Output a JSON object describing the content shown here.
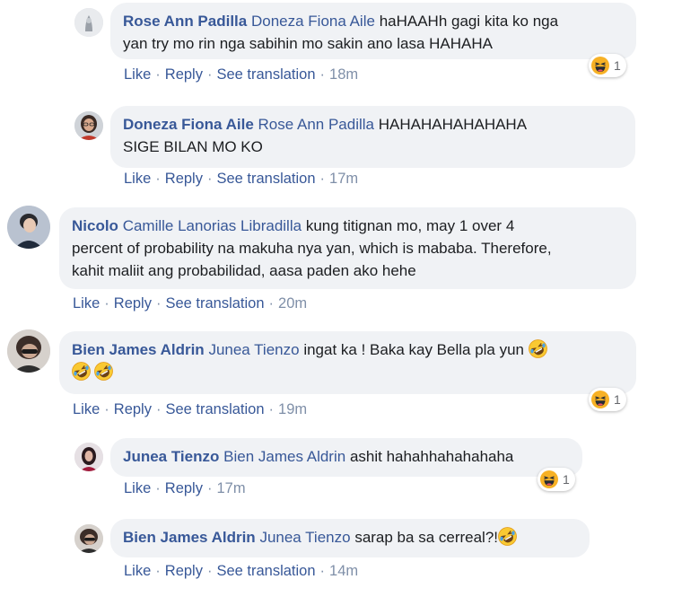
{
  "comments": [
    {
      "author": "Rose Ann Padilla",
      "tag": "Doneza Fiona Aile",
      "text_lines": [
        "haHAAHh gagi kita ko nga",
        "yan try mo rin nga sabihin mo sakin ano lasa HAHAHA"
      ],
      "actions": {
        "like": "Like",
        "reply": "Reply",
        "translate": "See translation",
        "time": "18m"
      },
      "reaction": {
        "icon": "haha-reaction-icon",
        "count": "1"
      }
    },
    {
      "author": "Doneza Fiona Aile",
      "tag": "Rose Ann Padilla",
      "text_lines": [
        "HAHAHAHAHAHAHA",
        "SIGE BILAN MO KO"
      ],
      "actions": {
        "like": "Like",
        "reply": "Reply",
        "translate": "See translation",
        "time": "17m"
      }
    },
    {
      "author": "Nicolo",
      "tag": "Camille Lanorias Libradilla",
      "text_lines": [
        "kung titignan mo, may 1 over 4",
        "percent of probability na makuha nya yan, which is mababa. Therefore,",
        "kahit maliit ang probabilidad, aasa paden ako hehe"
      ],
      "actions": {
        "like": "Like",
        "reply": "Reply",
        "translate": "See translation",
        "time": "20m"
      }
    },
    {
      "author": "Bien James Aldrin",
      "tag": "Junea Tienzo",
      "text_lines": [
        "ingat ka ! Baka kay Bella pla yun"
      ],
      "emoji": "rolling-laughing-emoji",
      "actions": {
        "like": "Like",
        "reply": "Reply",
        "translate": "See translation",
        "time": "19m"
      },
      "reaction": {
        "icon": "haha-reaction-icon",
        "count": "1"
      }
    },
    {
      "author": "Junea Tienzo",
      "tag": "Bien James Aldrin",
      "text_lines": [
        "ashit hahahhahahahaha"
      ],
      "actions": {
        "like": "Like",
        "reply": "Reply",
        "time": "17m"
      },
      "reaction": {
        "icon": "haha-reaction-icon",
        "count": "1"
      }
    },
    {
      "author": "Bien James Aldrin",
      "tag": "Junea Tienzo",
      "text_lines": [
        "sarap ba sa cerreal?!"
      ],
      "emoji": "rolling-laughing-emoji",
      "actions": {
        "like": "Like",
        "reply": "Reply",
        "translate": "See translation",
        "time": "14m"
      }
    }
  ],
  "colors": {
    "name": "#385898",
    "bubble": "#f0f2f5",
    "meta": "#7f8fa8"
  }
}
